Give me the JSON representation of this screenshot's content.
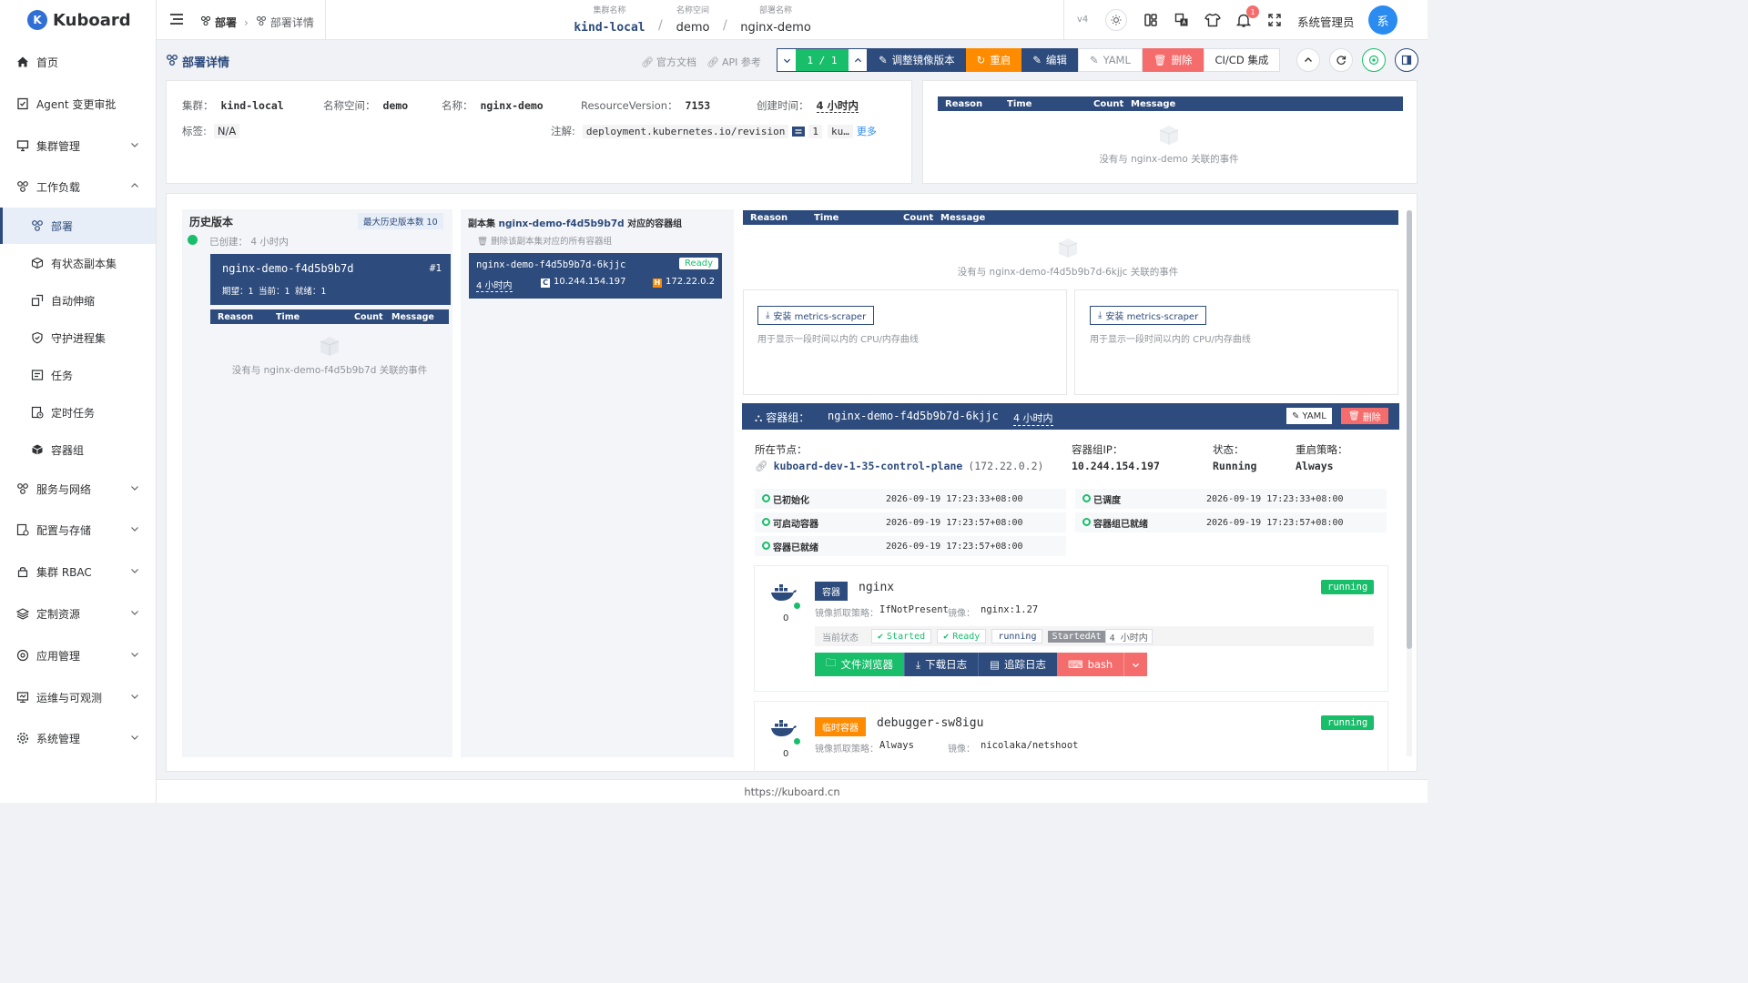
{
  "app": {
    "logo_letter": "K",
    "logo_name": "Kuboard"
  },
  "sidebar": {
    "items": [
      {
        "label": "首页"
      },
      {
        "label": "Agent 变更审批"
      },
      {
        "label": "集群管理"
      },
      {
        "label": "工作负载"
      },
      {
        "label": "部署"
      },
      {
        "label": "有状态副本集"
      },
      {
        "label": "自动伸缩"
      },
      {
        "label": "守护进程集"
      },
      {
        "label": "任务"
      },
      {
        "label": "定时任务"
      },
      {
        "label": "容器组"
      },
      {
        "label": "服务与网络"
      },
      {
        "label": "配置与存储"
      },
      {
        "label": "集群 RBAC"
      },
      {
        "label": "定制资源"
      },
      {
        "label": "应用管理"
      },
      {
        "label": "运维与可观测"
      },
      {
        "label": "系统管理"
      }
    ]
  },
  "header": {
    "crumb1": "部署",
    "crumb2": "部署详情",
    "cluster_label": "集群名称",
    "cluster": "kind-local",
    "ns_label": "名称空间",
    "ns": "demo",
    "deploy_label": "部署名称",
    "deploy": "nginx-demo",
    "version": "v4",
    "user": "系统管理员",
    "avatar": "系",
    "notif_count": "1"
  },
  "title": {
    "text": "部署详情",
    "docs": "官方文档",
    "api": "API 参考"
  },
  "toolbar": {
    "pager": "1 / 1",
    "adjust": "调整镜像版本",
    "restart": "重启",
    "edit": "编辑",
    "yaml": "YAML",
    "delete": "删除",
    "cicd": "CI/CD 集成"
  },
  "meta": {
    "cluster_k": "集群：",
    "cluster_v": "kind-local",
    "ns_k": "名称空间：",
    "ns_v": "demo",
    "name_k": "名称：",
    "name_v": "nginx-demo",
    "rv_k": "ResourceVersion：",
    "rv_v": "7153",
    "ct_k": "创建时间：",
    "ct_v": "4 小时内",
    "labels_k": "标签:",
    "labels_v": "N/A",
    "ann_k": "注解:",
    "ann_key": "deployment.kubernetes.io/revision",
    "ann_val": "1",
    "ann_more_key": "ku…",
    "more": "更多"
  },
  "events_header": {
    "reason": "Reason",
    "time": "Time",
    "count": "Count",
    "message": "Message"
  },
  "events_top": {
    "empty": "没有与 nginx-demo 关联的事件"
  },
  "history": {
    "title": "历史版本",
    "max": "最大历史版本数 10",
    "created": "已创建： 4 小时内",
    "rs_name": "nginx-demo-f4d5b9b7d",
    "rs_rev": "#1",
    "rs_detail": "期望：1 当前：1 就绪：1",
    "empty": "没有与 nginx-demo-f4d5b9b7d 关联的事件"
  },
  "rs_pods": {
    "title_prefix": "副本集",
    "rs": "nginx-demo-f4d5b9b7d",
    "title_suffix": "对应的容器组",
    "delete_all": "删除该副本集对应的所有容器组",
    "pod_name": "nginx-demo-f4d5b9b7d-6kjjc",
    "status": "Ready",
    "age": "4 小时内",
    "pod_ip": "10.244.154.197",
    "host_ip": "172.22.0.2",
    "c_letter": "C",
    "h_letter": "H"
  },
  "pod_events": {
    "empty": "没有与 nginx-demo-f4d5b9b7d-6kjjc 关联的事件"
  },
  "metrics": {
    "button": "安装 metrics-scraper",
    "desc": "用于显示一段时间以内的 CPU/内存曲线"
  },
  "pod": {
    "header_label": "容器组：",
    "name": "nginx-demo-f4d5b9b7d-6kjjc",
    "age": "4 小时内",
    "yaml": "YAML",
    "delete": "删除",
    "node_k": "所在节点：",
    "node_v": "kuboard-dev-1-35-control-plane",
    "node_ip": "(172.22.0.2)",
    "ip_k": "容器组IP：",
    "ip_v": "10.244.154.197",
    "status_k": "状态：",
    "status_v": "Running",
    "restart_k": "重启策略：",
    "restart_v": "Always"
  },
  "conditions": [
    {
      "name": "已初始化",
      "time": "2026-09-19 17:23:33+08:00"
    },
    {
      "name": "已调度",
      "time": "2026-09-19 17:23:33+08:00"
    },
    {
      "name": "可启动容器",
      "time": "2026-09-19 17:23:57+08:00"
    },
    {
      "name": "容器组已就绪",
      "time": "2026-09-19 17:23:57+08:00"
    },
    {
      "name": "容器已就绪",
      "time": "2026-09-19 17:23:57+08:00"
    }
  ],
  "container1": {
    "type": "容器",
    "name": "nginx",
    "status": "running",
    "restarts": "0",
    "policy_k": "镜像抓取策略：",
    "policy_v": "IfNotPresent",
    "image_k": "镜像：",
    "image_v": "nginx:1.27",
    "state_k": "当前状态",
    "started": "Started",
    "ready": "Ready",
    "running": "running",
    "startedat": "StartedAt",
    "startedat_v": "4 小时内",
    "files": "文件浏览器",
    "download": "下载日志",
    "follow": "追踪日志",
    "bash": "bash"
  },
  "container2": {
    "type": "临时容器",
    "name": "debugger-sw8igu",
    "status": "running",
    "restarts": "0",
    "policy_k": "镜像抓取策略：",
    "policy_v": "Always",
    "image_k": "镜像：",
    "image_v": "nicolaka/netshoot"
  },
  "footer": {
    "url": "https://kuboard.cn"
  },
  "colors": {
    "primary": "#2d4b7c",
    "green": "#19be6b",
    "orange": "#ff8c00",
    "red": "#f56c6c",
    "blue": "#2a8cf0"
  }
}
